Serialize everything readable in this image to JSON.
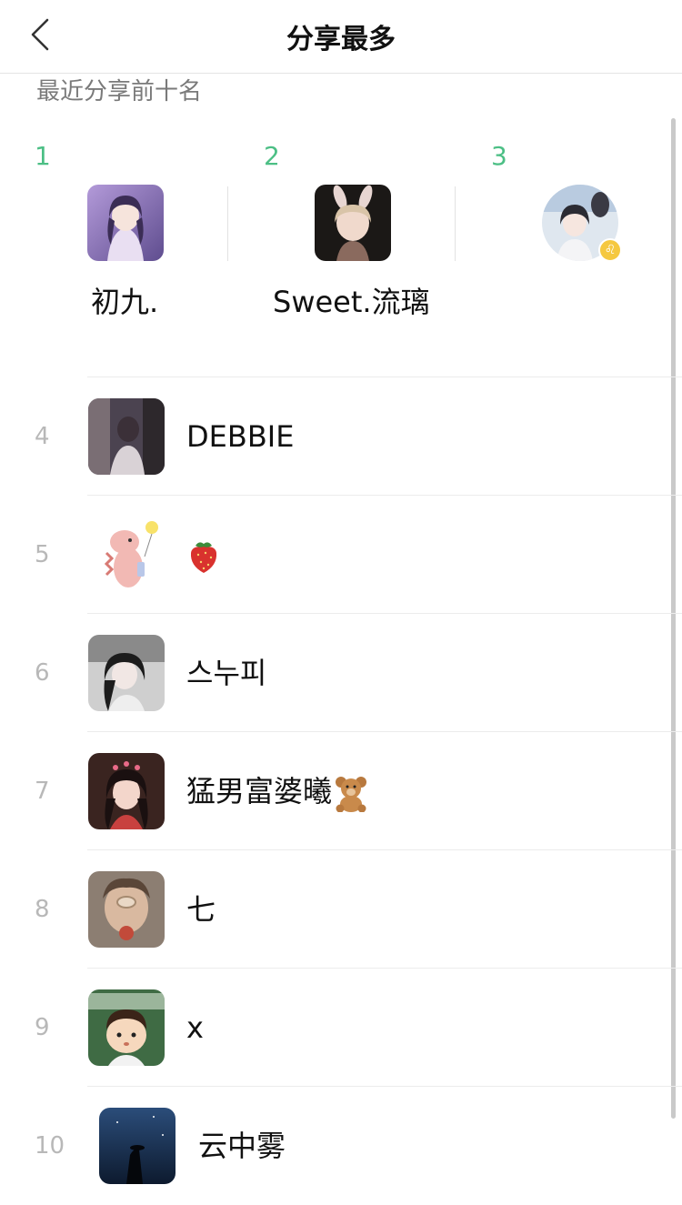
{
  "header": {
    "title": "分享最多",
    "back_icon": "chevron-left-icon"
  },
  "section": {
    "subtitle": "最近分享前十名"
  },
  "top_three": [
    {
      "rank": "1",
      "name": "初九."
    },
    {
      "rank": "2",
      "name": "Sweet.流璃"
    },
    {
      "rank": "3",
      "name": ""
    }
  ],
  "list": [
    {
      "rank": "4",
      "name": "DEBBIE"
    },
    {
      "rank": "5",
      "name": "",
      "emoji": "strawberry-icon"
    },
    {
      "rank": "6",
      "name": "스누피"
    },
    {
      "rank": "7",
      "name": "猛男富婆曦",
      "emoji": "teddy-bear-icon"
    },
    {
      "rank": "8",
      "name": "七"
    },
    {
      "rank": "9",
      "name": "x"
    },
    {
      "rank": "10",
      "name": "云中雾"
    }
  ],
  "colors": {
    "accent_green": "#4cbf85",
    "rank_gray": "#b8b8b8",
    "subtitle_gray": "#7a7a7a",
    "badge_yellow": "#f5c840"
  }
}
